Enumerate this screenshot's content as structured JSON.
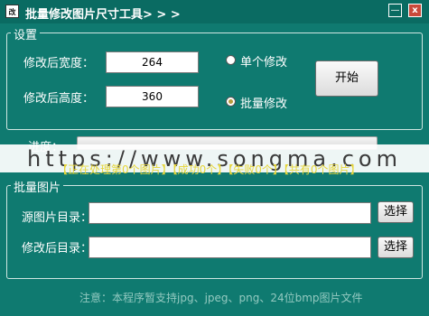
{
  "window": {
    "icon_text": "改",
    "title": "批量修改图片尺寸工具> > >",
    "minimize_label": "—",
    "close_label": "x"
  },
  "settings": {
    "legend": "设置",
    "width_label": "修改后宽度：",
    "width_value": "264",
    "height_label": "修改后高度：",
    "height_value": "360",
    "single_label": "单个修改",
    "batch_label": "批量修改",
    "selected_mode": "batch",
    "start_label": "开始"
  },
  "progress": {
    "label": "进度：",
    "status_line": "【正在处理第0个图片】【成功0个】【失败0个】【共有0个图片】"
  },
  "watermark": {
    "text": "https://www.songma.com"
  },
  "batch": {
    "legend": "批量图片",
    "source_label": "源图片目录：",
    "source_value": "",
    "target_label": "修改后目录：",
    "target_value": "",
    "browse_label": "选择"
  },
  "footer": {
    "note": "注意：本程序暂支持jpg、jpeg、png、24位bmp图片文件"
  }
}
